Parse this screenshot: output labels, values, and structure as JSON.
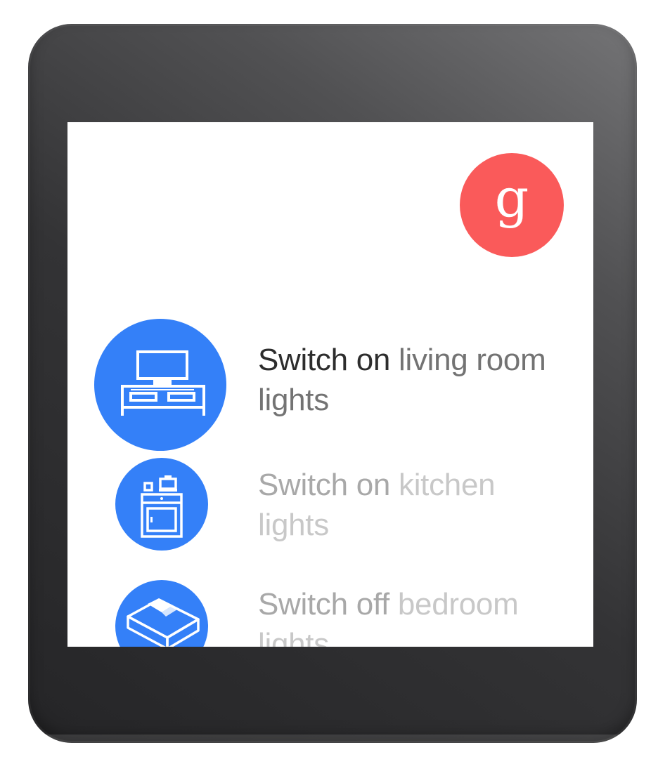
{
  "assistant_badge": {
    "glyph": "g",
    "color": "#fa5a5a"
  },
  "suggestions": [
    {
      "verb": "Switch on",
      "object": "living room",
      "tail": "lights",
      "icon": "tv-stand-icon",
      "state": "focused"
    },
    {
      "verb": "Switch on",
      "object": "kitchen",
      "tail": "lights",
      "icon": "kitchen-stove-icon",
      "state": "dimmed"
    },
    {
      "verb": "Switch off",
      "object": "bedroom",
      "tail": "lights",
      "icon": "bed-icon",
      "state": "dimmed"
    }
  ],
  "colors": {
    "accent_blue": "#3480f8",
    "screen_background": "#ffffff",
    "watch_bezel": "#3a3a3c"
  }
}
